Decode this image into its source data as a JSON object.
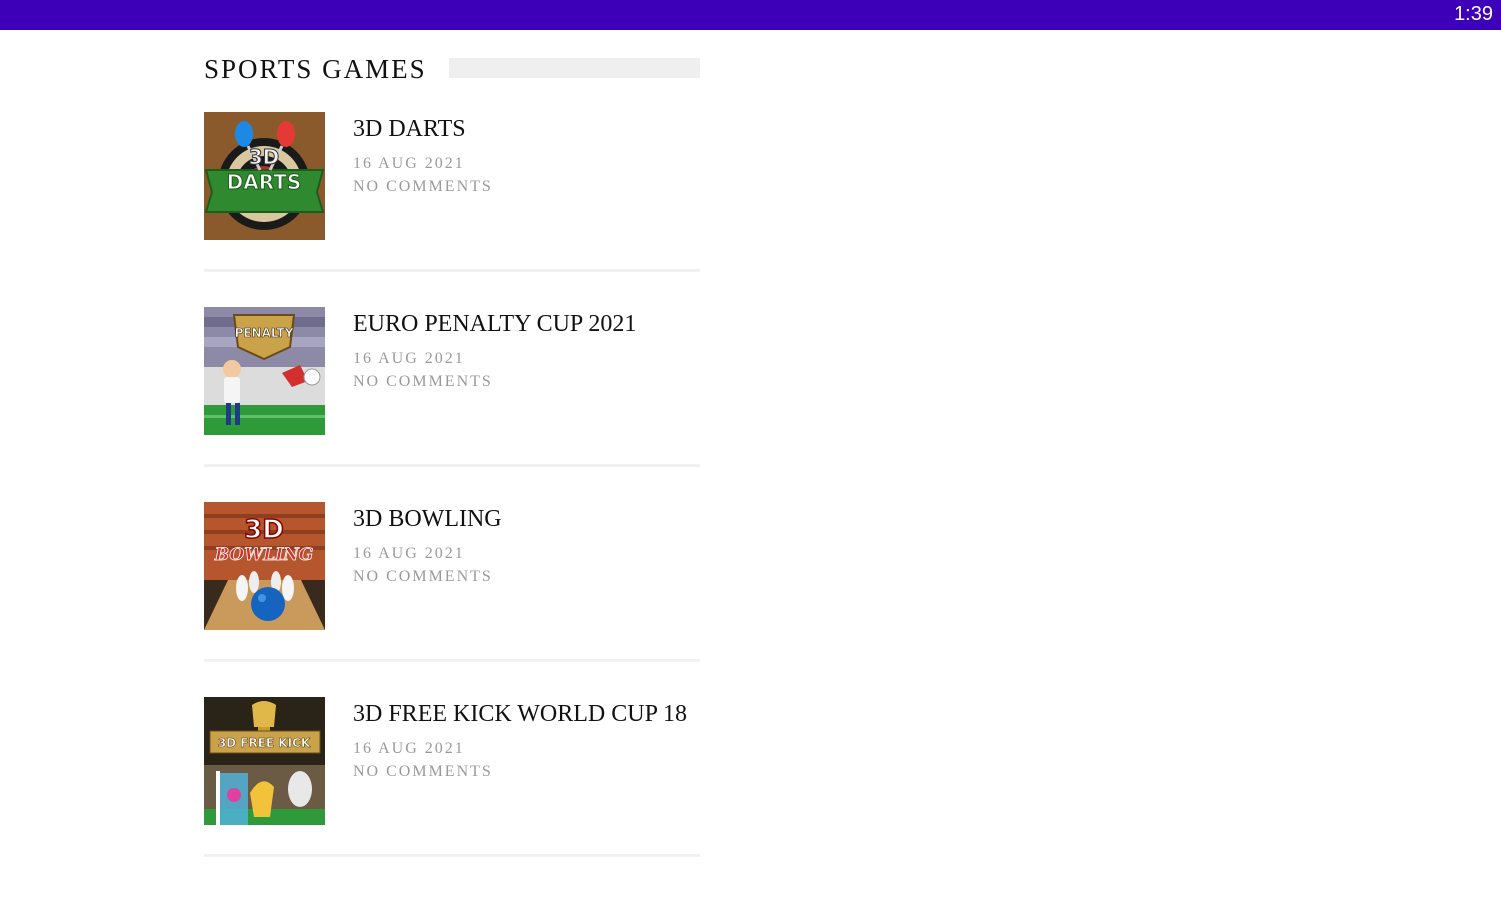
{
  "status_bar": {
    "time": "1:39",
    "color": "#3d00b8"
  },
  "widget": {
    "title": "SPORTS GAMES",
    "posts": [
      {
        "title": "3D DARTS",
        "date": "16 AUG 2021",
        "comments": "NO COMMENTS",
        "thumb_icon": "darts-game-thumbnail",
        "thumb_text": [
          "3D",
          "DARTS"
        ]
      },
      {
        "title": "EURO PENALTY CUP 2021",
        "date": "16 AUG 2021",
        "comments": "NO COMMENTS",
        "thumb_icon": "penalty-game-thumbnail",
        "thumb_text": [
          "PENALTY"
        ]
      },
      {
        "title": "3D BOWLING",
        "date": "16 AUG 2021",
        "comments": "NO COMMENTS",
        "thumb_icon": "bowling-game-thumbnail",
        "thumb_text": [
          "3D",
          "BOWLING"
        ]
      },
      {
        "title": "3D FREE KICK WORLD CUP 18",
        "date": "16 AUG 2021",
        "comments": "NO COMMENTS",
        "thumb_icon": "free-kick-game-thumbnail",
        "thumb_text": [
          "3D FREE KICK"
        ]
      }
    ]
  }
}
